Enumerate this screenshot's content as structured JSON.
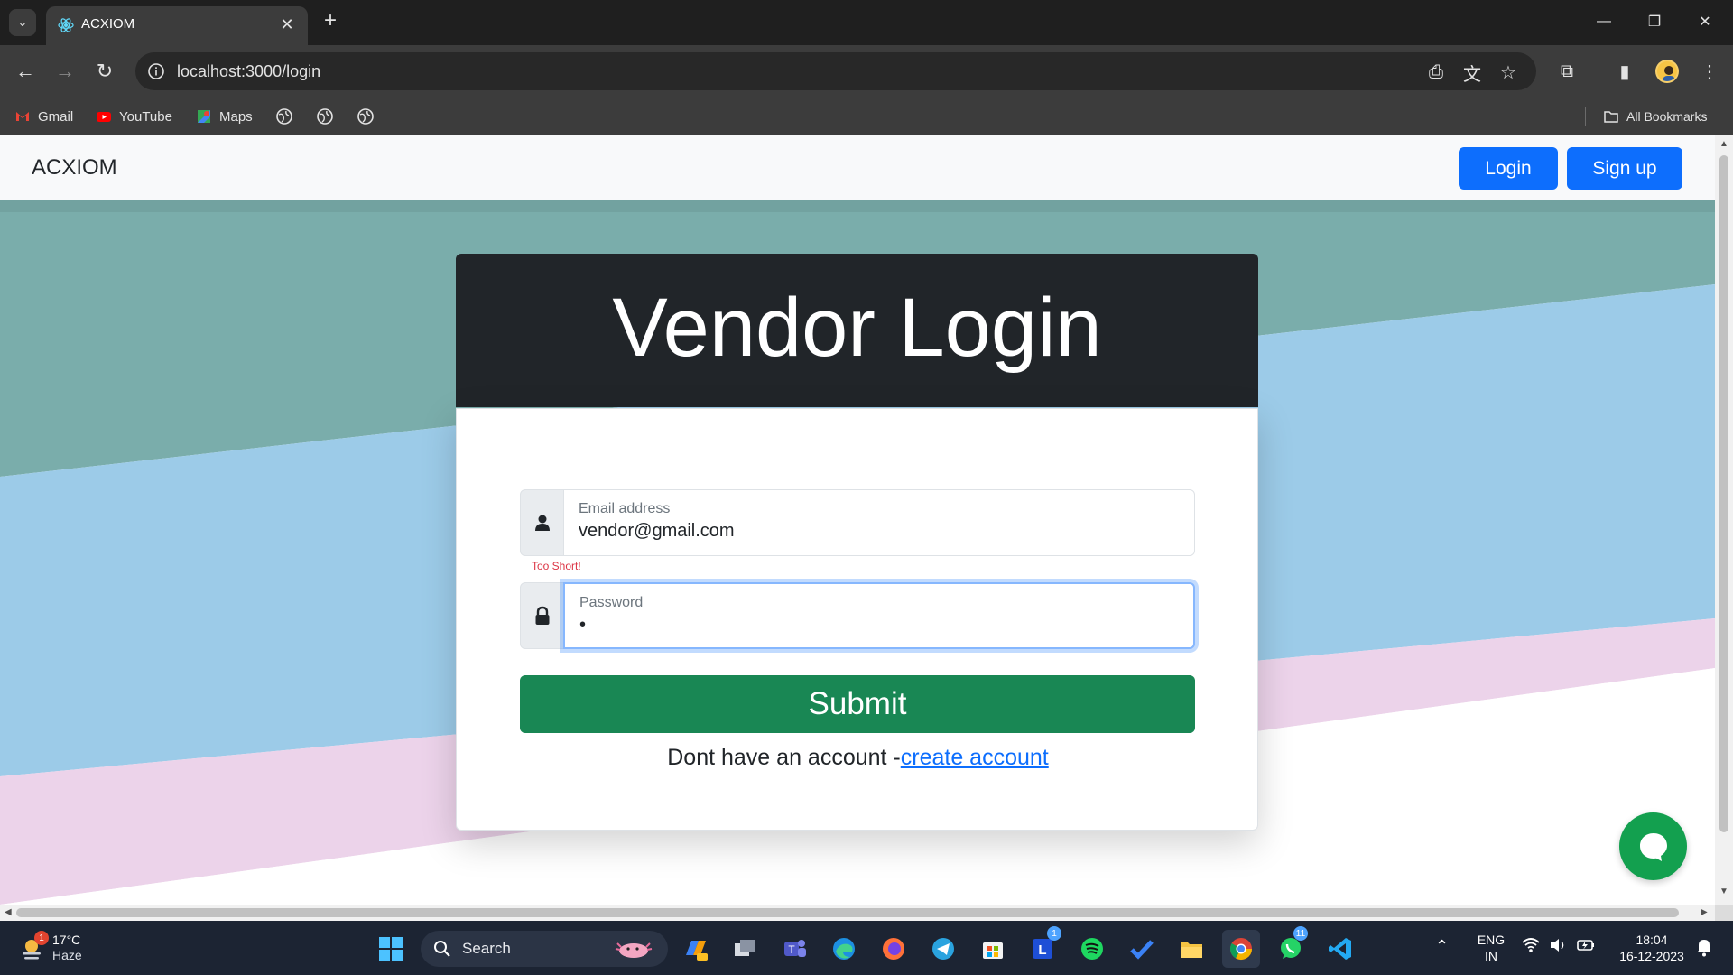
{
  "browser": {
    "tab_title": "ACXIOM",
    "url": "localhost:3000/login",
    "bookmarks": [
      {
        "label": "Gmail",
        "icon": "gmail-icon"
      },
      {
        "label": "YouTube",
        "icon": "youtube-icon"
      },
      {
        "label": "Maps",
        "icon": "maps-icon"
      }
    ],
    "all_bookmarks_label": "All Bookmarks"
  },
  "navbar": {
    "brand": "ACXIOM",
    "login_label": "Login",
    "signup_label": "Sign up"
  },
  "form": {
    "title": "Vendor Login",
    "email_label": "Email address",
    "email_value": "vendor@gmail.com",
    "error": "Too Short!",
    "password_label": "Password",
    "password_value": "•",
    "submit_label": "Submit",
    "signup_prompt": "Dont have an account -",
    "signup_link": "create account"
  },
  "colors": {
    "primary": "#0d6efd",
    "success": "#198754",
    "dark": "#212529",
    "error": "#dc3545",
    "bg_teal": "#7aadab",
    "bg_blue": "#9ccbe8",
    "bg_pink": "#ecd3ea"
  },
  "taskbar": {
    "weather_temp": "17°C",
    "weather_cond": "Haze",
    "weather_badge": "1",
    "search_label": "Search",
    "lang_line1": "ENG",
    "lang_line2": "IN",
    "time": "18:04",
    "date": "16-12-2023",
    "badge_l": "1",
    "badge_whatsapp": "11"
  }
}
